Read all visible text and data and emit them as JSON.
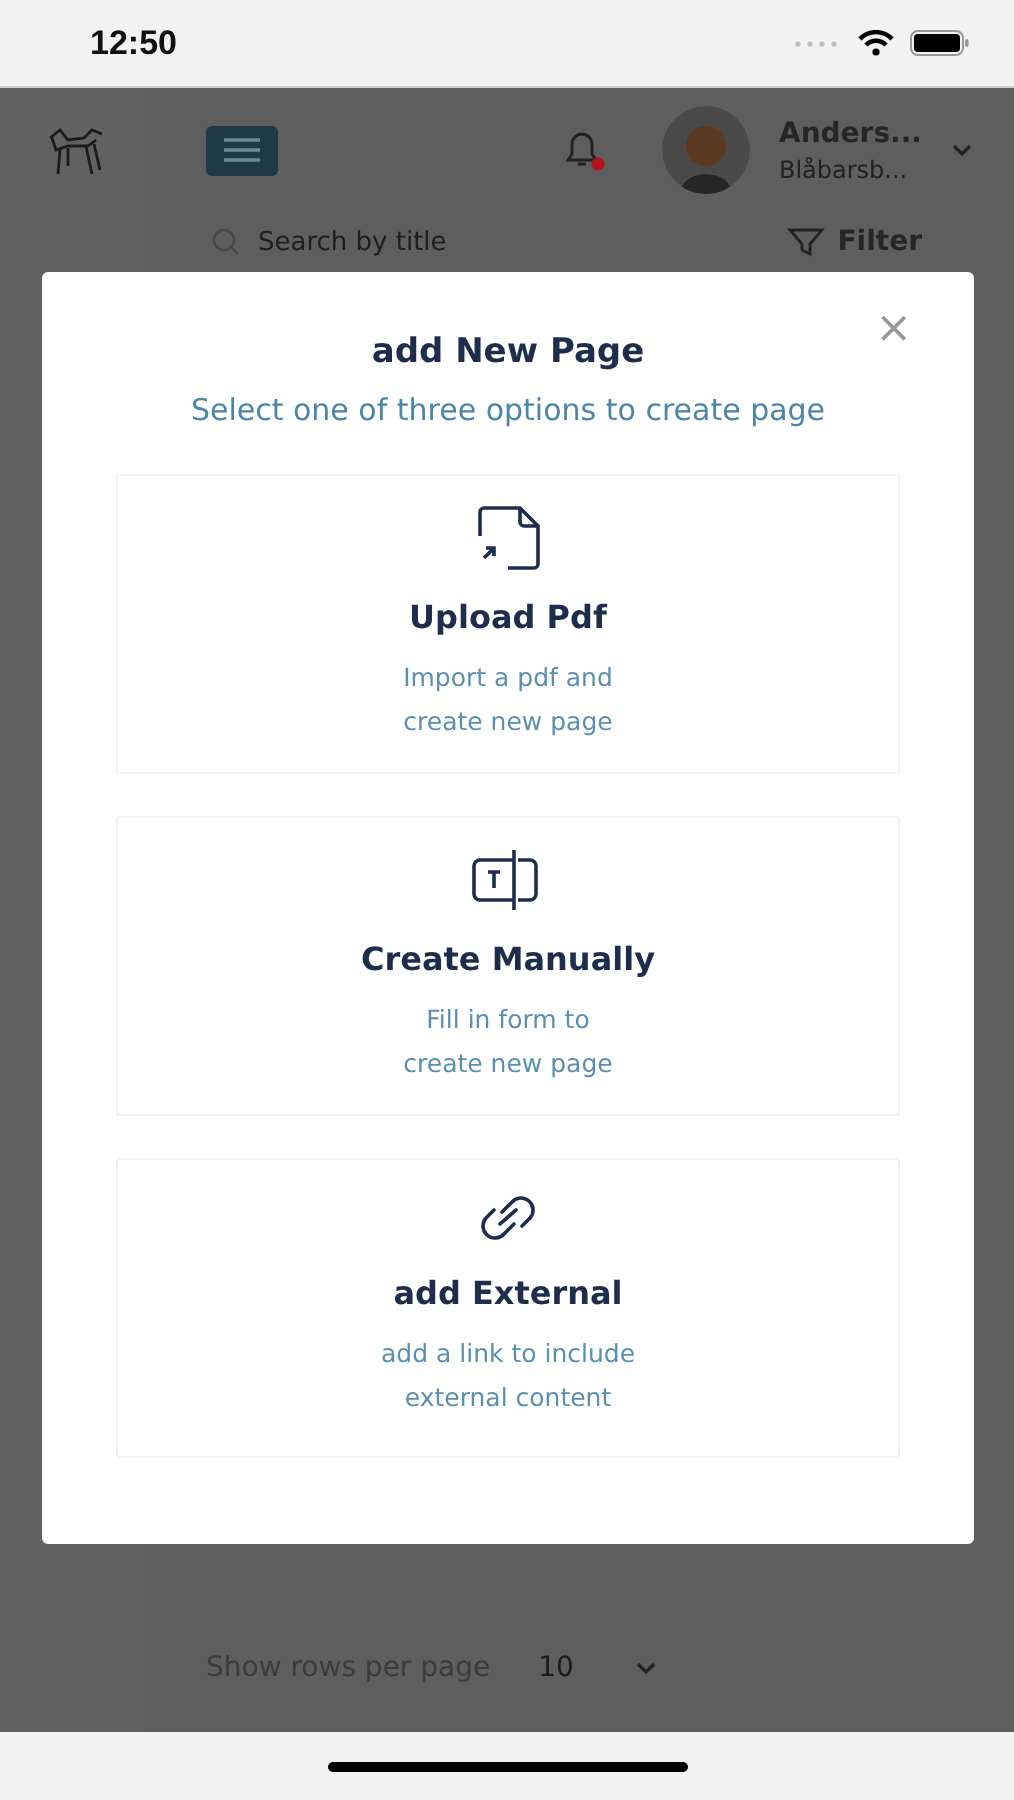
{
  "status_bar": {
    "time": "12:50"
  },
  "header": {
    "user_name": "Anders...",
    "user_org": "Blåbarsb...",
    "notification_unread": true
  },
  "search": {
    "placeholder": "Search by title"
  },
  "filter_button": {
    "label": "Filter"
  },
  "dialog": {
    "title": "add New Page",
    "subtitle": "Select one of three options to create page",
    "close_label": "×",
    "options": [
      {
        "kind": "upload",
        "title": "Upload Pdf",
        "lines": [
          "Import a pdf and",
          "create new page"
        ]
      },
      {
        "kind": "manual",
        "title": "Create Manually",
        "lines": [
          "Fill in form to",
          "create new page"
        ]
      },
      {
        "kind": "link",
        "title": "add External",
        "lines": [
          "add a link to include",
          "external content"
        ]
      }
    ]
  },
  "pagination": {
    "label": "Show rows per page",
    "rows_value": "10"
  }
}
